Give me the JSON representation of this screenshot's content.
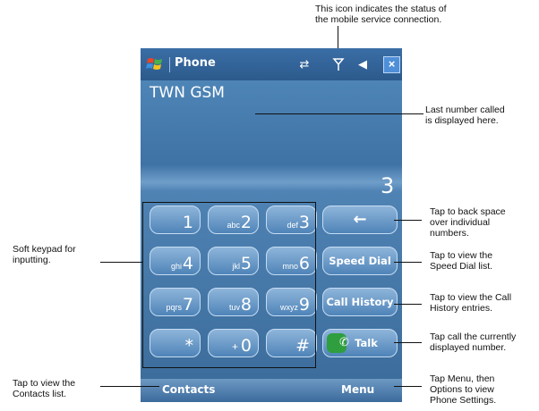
{
  "annotations": {
    "status_icon": "This icon indicates the status of the mobile service connection.",
    "status_icon_line1": "This icon indicates the status of",
    "status_icon_line2": "the mobile service connection.",
    "last_number_line1": "Last number called",
    "last_number_line2": "is displayed here.",
    "backspace_line1": "Tap to back space",
    "backspace_line2": "over individual",
    "backspace_line3": "numbers.",
    "speed_dial_line1": "Tap to view the",
    "speed_dial_line2": "Speed Dial list.",
    "call_history_line1": "Tap to view the Call",
    "call_history_line2": "History entries.",
    "talk_line1": "Tap call the currently",
    "talk_line2": "displayed number.",
    "menu_line1": "Tap Menu, then",
    "menu_line2": "Options to view",
    "menu_line3": "Phone Settings.",
    "keypad_line1": "Soft keypad for",
    "keypad_line2": "inputting.",
    "contacts_line1": "Tap to view the",
    "contacts_line2": "Contacts list."
  },
  "device": {
    "title": "Phone",
    "carrier": "TWN GSM",
    "dialed_number": "3",
    "status_icons": [
      "connectivity-icon",
      "signal-antenna-icon",
      "speaker-icon"
    ],
    "close_label": "×"
  },
  "keypad": [
    {
      "sub": "",
      "num": "1"
    },
    {
      "sub": "abc",
      "num": "2"
    },
    {
      "sub": "def",
      "num": "3"
    },
    {
      "sub": "ghi",
      "num": "4"
    },
    {
      "sub": "jkl",
      "num": "5"
    },
    {
      "sub": "mno",
      "num": "6"
    },
    {
      "sub": "pqrs",
      "num": "7"
    },
    {
      "sub": "tuv",
      "num": "8"
    },
    {
      "sub": "wxyz",
      "num": "9"
    },
    {
      "sub": "",
      "num": "*"
    },
    {
      "sub": "+",
      "num": "0"
    },
    {
      "sub": "",
      "num": "#"
    }
  ],
  "function_keys": {
    "backspace": "←",
    "speed_dial": "Speed Dial",
    "call_history": "Call History",
    "talk": "Talk"
  },
  "softkeys": {
    "left": "Contacts",
    "right": "Menu"
  }
}
